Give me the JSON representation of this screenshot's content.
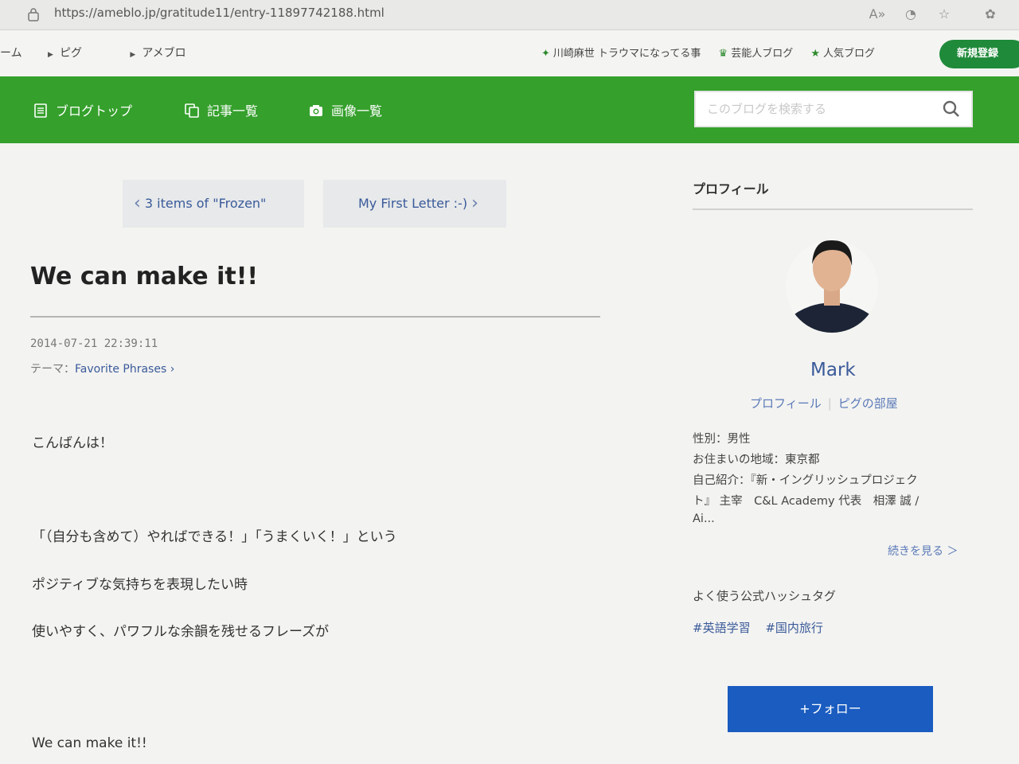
{
  "browser": {
    "url": "https://ameblo.jp/gratitude11/entry-11897742188.html"
  },
  "sitebar": {
    "crumbs": [
      "ーム",
      "ピグ",
      "アメブロ"
    ],
    "links": [
      "川崎麻世 トラウマになってる事",
      "芸能人ブログ",
      "人気ブログ"
    ],
    "signup": "新規登録"
  },
  "nav": {
    "items": [
      "ブログトップ",
      "記事一覧",
      "画像一覧"
    ],
    "search_placeholder": "このブログを検索する"
  },
  "pager": {
    "prev": "3 items of \"Frozen\"",
    "next": "My First Letter :-)"
  },
  "article": {
    "title": "We can make it!!",
    "date": "2014-07-21 22:39:11",
    "theme_label": "テーマ：",
    "theme": "Favorite Phrases",
    "body": [
      "こんばんは！",
      "「（自分も含めて）やればできる！」「うまくいく！」という",
      "ポジティブな気持ちを表現したい時",
      "使いやすく、パワフルな余韻を残せるフレーズが",
      "We can make it!!"
    ]
  },
  "profile": {
    "heading": "プロフィール",
    "name": "Mark",
    "link_profile": "プロフィール",
    "link_room": "ピグの部屋",
    "gender": "性別：男性",
    "region": "お住まいの地域：東京都",
    "intro_1": "自己紹介：『新・イングリッシュプロジェク",
    "intro_2": "ト』 主宰　C&L Academy 代表　相澤 誠 /",
    "intro_3": "Ai...",
    "more": "続きを見る ＞",
    "tags_heading": "よく使う公式ハッシュタグ",
    "tags": [
      "#英語学習",
      "#国内旅行"
    ],
    "follow": "+フォロー"
  },
  "colors": {
    "nav_green": "#35a02c",
    "follow_blue": "#1a5cc0",
    "link_blue": "#3a5a9a"
  }
}
